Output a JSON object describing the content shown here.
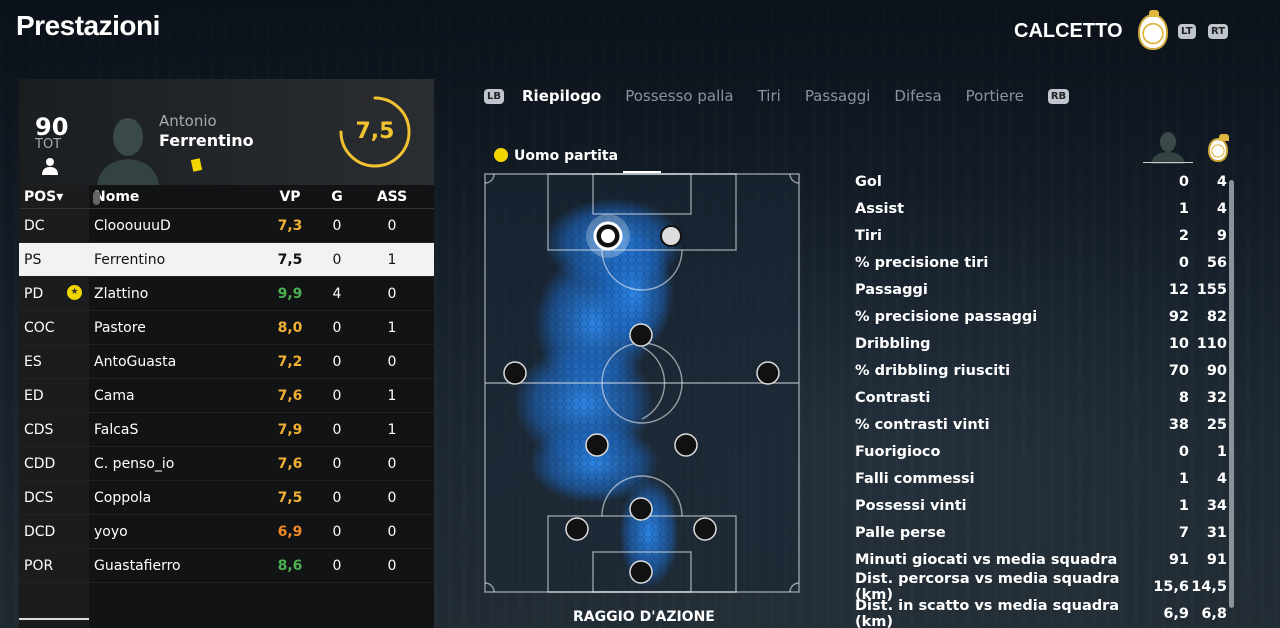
{
  "header": {
    "title": "Prestazioni",
    "mode": "CALCETTO",
    "hint_lt": "LT",
    "hint_rt": "RT"
  },
  "player": {
    "overall": "90",
    "overall_label": "TOT",
    "first_name": "Antonio",
    "last_name": "Ferrentino",
    "rating": "7,5",
    "rating_fraction": 0.75
  },
  "table": {
    "headers": {
      "pos": "POS▾",
      "name": "Nome",
      "vp": "VP",
      "g": "G",
      "ass": "ASS"
    },
    "rows": [
      {
        "pos": "DC",
        "name": "ClooouuuD",
        "vp": "7,3",
        "g": "0",
        "ass": "0",
        "vp_color": "#f2b134"
      },
      {
        "pos": "PS",
        "name": "Ferrentino",
        "vp": "7,5",
        "g": "0",
        "ass": "1",
        "vp_color": "#111111",
        "selected": true
      },
      {
        "pos": "PD",
        "name": "Zlattino",
        "vp": "9,9",
        "g": "4",
        "ass": "0",
        "vp_color": "#4caf50",
        "motm": true
      },
      {
        "pos": "COC",
        "name": "Pastore",
        "vp": "8,0",
        "g": "0",
        "ass": "1",
        "vp_color": "#f2b134"
      },
      {
        "pos": "ES",
        "name": "AntoGuasta",
        "vp": "7,2",
        "g": "0",
        "ass": "0",
        "vp_color": "#f2b134"
      },
      {
        "pos": "ED",
        "name": "Cama",
        "vp": "7,6",
        "g": "0",
        "ass": "1",
        "vp_color": "#f2b134"
      },
      {
        "pos": "CDS",
        "name": "FalcaS",
        "vp": "7,9",
        "g": "0",
        "ass": "1",
        "vp_color": "#f2b134"
      },
      {
        "pos": "CDD",
        "name": "C. penso_io",
        "vp": "7,6",
        "g": "0",
        "ass": "0",
        "vp_color": "#f2b134"
      },
      {
        "pos": "DCS",
        "name": "Coppola",
        "vp": "7,5",
        "g": "0",
        "ass": "0",
        "vp_color": "#f2b134"
      },
      {
        "pos": "DCD",
        "name": "yoyo",
        "vp": "6,9",
        "g": "0",
        "ass": "0",
        "vp_color": "#f08a24"
      },
      {
        "pos": "POR",
        "name": "Guastafierro",
        "vp": "8,6",
        "g": "0",
        "ass": "0",
        "vp_color": "#4caf50"
      }
    ]
  },
  "tabs": {
    "hint_lb": "LB",
    "hint_rb": "RB",
    "items": [
      "Riepilogo",
      "Possesso palla",
      "Tiri",
      "Passaggi",
      "Difesa",
      "Portiere"
    ],
    "active": 0
  },
  "motm_label": "Uomo partita",
  "pitch_label": "RAGGIO D'AZIONE",
  "stats": [
    {
      "label": "Gol",
      "a": "0",
      "b": "4"
    },
    {
      "label": "Assist",
      "a": "1",
      "b": "4"
    },
    {
      "label": "Tiri",
      "a": "2",
      "b": "9"
    },
    {
      "label": "% precisione tiri",
      "a": "0",
      "b": "56"
    },
    {
      "label": "Passaggi",
      "a": "12",
      "b": "155"
    },
    {
      "label": "% precisione passaggi",
      "a": "92",
      "b": "82"
    },
    {
      "label": "Dribbling",
      "a": "10",
      "b": "110"
    },
    {
      "label": "% dribbling riusciti",
      "a": "70",
      "b": "90"
    },
    {
      "label": "Contrasti",
      "a": "8",
      "b": "32"
    },
    {
      "label": "% contrasti vinti",
      "a": "38",
      "b": "25"
    },
    {
      "label": "Fuorigioco",
      "a": "0",
      "b": "1"
    },
    {
      "label": "Falli commessi",
      "a": "1",
      "b": "4"
    },
    {
      "label": "Possessi vinti",
      "a": "1",
      "b": "34"
    },
    {
      "label": "Palle perse",
      "a": "7",
      "b": "31"
    },
    {
      "label": "Minuti giocati vs media squadra",
      "a": "91",
      "b": "91"
    },
    {
      "label": "Dist. percorsa vs media squadra (km)",
      "a": "15,6",
      "b": "14,5"
    },
    {
      "label": "Dist. in scatto vs media squadra (km)",
      "a": "6,9",
      "b": "6,8"
    }
  ],
  "colors": {
    "accent": "#f2c230",
    "heatmap": "#2e8cf0",
    "panel": "#111315"
  }
}
